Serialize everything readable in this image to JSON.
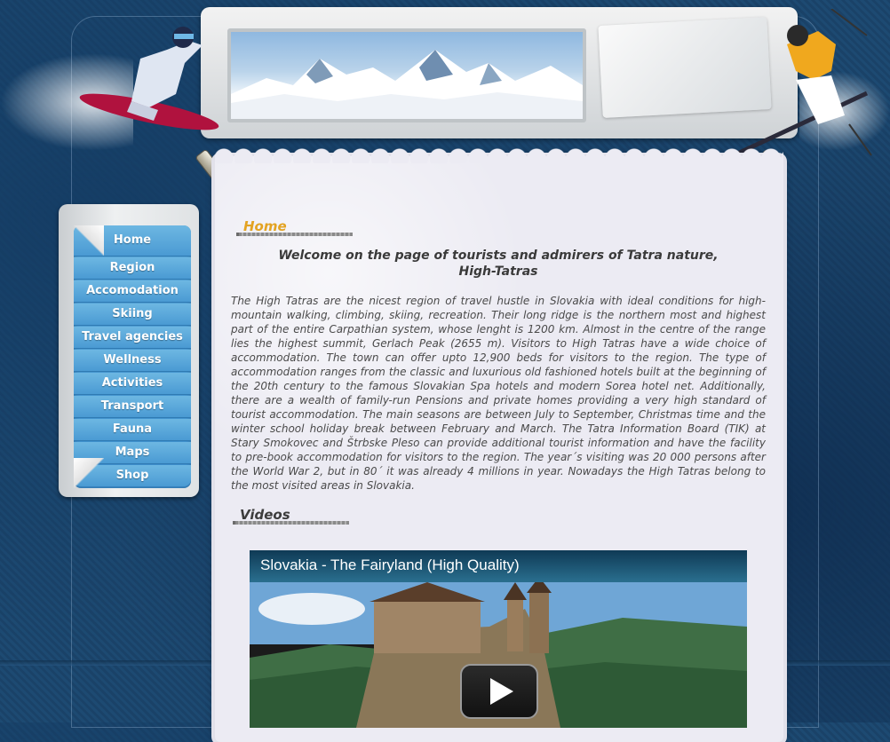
{
  "nav": {
    "items": [
      {
        "label": "Home"
      },
      {
        "label": "Region"
      },
      {
        "label": "Accomodation"
      },
      {
        "label": "Skiing"
      },
      {
        "label": "Travel agencies"
      },
      {
        "label": "Wellness"
      },
      {
        "label": "Activities"
      },
      {
        "label": "Transport"
      },
      {
        "label": "Fauna"
      },
      {
        "label": "Maps"
      },
      {
        "label": "Shop"
      }
    ]
  },
  "main": {
    "home_heading": "Home",
    "welcome_line1": "Welcome on the page of tourists and admirers of Tatra nature,",
    "welcome_line2": "High-Tatras",
    "body": "The High Tatras are the nicest region of travel hustle in Slovakia with ideal conditions for high-mountain walking, climbing, skiing, recreation. Their long ridge is the northern most and highest part of the entire Carpathian system, whose lenght is 1200 km. Almost in the centre of the range lies the highest summit, Gerlach Peak (2655 m). Visitors to High Tatras have a wide choice of accommodation. The town can offer upto 12,900 beds for visitors to the region. The type of accommodation ranges from the classic and luxurious old fashioned hotels built at the beginning of the 20th century to the famous Slovakian Spa hotels and modern Sorea hotel net. Additionally, there are a wealth of family-run Pensions and private homes providing a very high standard of tourist accommodation. The main seasons are between July to September, Christmas time and the winter school holiday break between February and March. The Tatra Information Board (TIK) at Stary Smokovec and Štrbske Pleso can provide additional tourist information and have the facility to pre-book accommodation for visitors to the region. The year´s visiting was 20 000 persons after the World War 2, but in 80´ it was already 4 millions in year. Nowadays the High Tatras belong to the most visited areas in Slovakia.",
    "videos_heading": "Videos"
  },
  "video": {
    "title": "Slovakia - The Fairyland (High Quality)"
  },
  "colors": {
    "background": "#1c456d",
    "menu_blue": "#4a9ad3",
    "home_heading": "#e3a322",
    "paper": "#ecebf3"
  }
}
